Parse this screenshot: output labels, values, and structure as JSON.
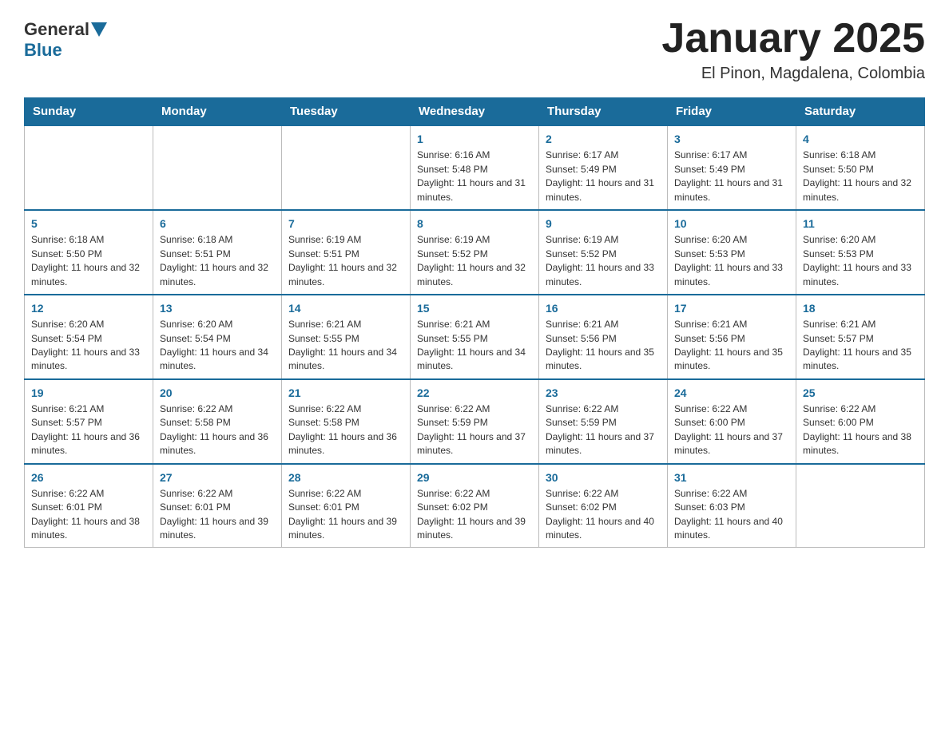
{
  "header": {
    "logo_general": "General",
    "logo_blue": "Blue",
    "month_title": "January 2025",
    "location": "El Pinon, Magdalena, Colombia"
  },
  "weekdays": [
    "Sunday",
    "Monday",
    "Tuesday",
    "Wednesday",
    "Thursday",
    "Friday",
    "Saturday"
  ],
  "weeks": [
    [
      {
        "day": "",
        "info": ""
      },
      {
        "day": "",
        "info": ""
      },
      {
        "day": "",
        "info": ""
      },
      {
        "day": "1",
        "info": "Sunrise: 6:16 AM\nSunset: 5:48 PM\nDaylight: 11 hours and 31 minutes."
      },
      {
        "day": "2",
        "info": "Sunrise: 6:17 AM\nSunset: 5:49 PM\nDaylight: 11 hours and 31 minutes."
      },
      {
        "day": "3",
        "info": "Sunrise: 6:17 AM\nSunset: 5:49 PM\nDaylight: 11 hours and 31 minutes."
      },
      {
        "day": "4",
        "info": "Sunrise: 6:18 AM\nSunset: 5:50 PM\nDaylight: 11 hours and 32 minutes."
      }
    ],
    [
      {
        "day": "5",
        "info": "Sunrise: 6:18 AM\nSunset: 5:50 PM\nDaylight: 11 hours and 32 minutes."
      },
      {
        "day": "6",
        "info": "Sunrise: 6:18 AM\nSunset: 5:51 PM\nDaylight: 11 hours and 32 minutes."
      },
      {
        "day": "7",
        "info": "Sunrise: 6:19 AM\nSunset: 5:51 PM\nDaylight: 11 hours and 32 minutes."
      },
      {
        "day": "8",
        "info": "Sunrise: 6:19 AM\nSunset: 5:52 PM\nDaylight: 11 hours and 32 minutes."
      },
      {
        "day": "9",
        "info": "Sunrise: 6:19 AM\nSunset: 5:52 PM\nDaylight: 11 hours and 33 minutes."
      },
      {
        "day": "10",
        "info": "Sunrise: 6:20 AM\nSunset: 5:53 PM\nDaylight: 11 hours and 33 minutes."
      },
      {
        "day": "11",
        "info": "Sunrise: 6:20 AM\nSunset: 5:53 PM\nDaylight: 11 hours and 33 minutes."
      }
    ],
    [
      {
        "day": "12",
        "info": "Sunrise: 6:20 AM\nSunset: 5:54 PM\nDaylight: 11 hours and 33 minutes."
      },
      {
        "day": "13",
        "info": "Sunrise: 6:20 AM\nSunset: 5:54 PM\nDaylight: 11 hours and 34 minutes."
      },
      {
        "day": "14",
        "info": "Sunrise: 6:21 AM\nSunset: 5:55 PM\nDaylight: 11 hours and 34 minutes."
      },
      {
        "day": "15",
        "info": "Sunrise: 6:21 AM\nSunset: 5:55 PM\nDaylight: 11 hours and 34 minutes."
      },
      {
        "day": "16",
        "info": "Sunrise: 6:21 AM\nSunset: 5:56 PM\nDaylight: 11 hours and 35 minutes."
      },
      {
        "day": "17",
        "info": "Sunrise: 6:21 AM\nSunset: 5:56 PM\nDaylight: 11 hours and 35 minutes."
      },
      {
        "day": "18",
        "info": "Sunrise: 6:21 AM\nSunset: 5:57 PM\nDaylight: 11 hours and 35 minutes."
      }
    ],
    [
      {
        "day": "19",
        "info": "Sunrise: 6:21 AM\nSunset: 5:57 PM\nDaylight: 11 hours and 36 minutes."
      },
      {
        "day": "20",
        "info": "Sunrise: 6:22 AM\nSunset: 5:58 PM\nDaylight: 11 hours and 36 minutes."
      },
      {
        "day": "21",
        "info": "Sunrise: 6:22 AM\nSunset: 5:58 PM\nDaylight: 11 hours and 36 minutes."
      },
      {
        "day": "22",
        "info": "Sunrise: 6:22 AM\nSunset: 5:59 PM\nDaylight: 11 hours and 37 minutes."
      },
      {
        "day": "23",
        "info": "Sunrise: 6:22 AM\nSunset: 5:59 PM\nDaylight: 11 hours and 37 minutes."
      },
      {
        "day": "24",
        "info": "Sunrise: 6:22 AM\nSunset: 6:00 PM\nDaylight: 11 hours and 37 minutes."
      },
      {
        "day": "25",
        "info": "Sunrise: 6:22 AM\nSunset: 6:00 PM\nDaylight: 11 hours and 38 minutes."
      }
    ],
    [
      {
        "day": "26",
        "info": "Sunrise: 6:22 AM\nSunset: 6:01 PM\nDaylight: 11 hours and 38 minutes."
      },
      {
        "day": "27",
        "info": "Sunrise: 6:22 AM\nSunset: 6:01 PM\nDaylight: 11 hours and 39 minutes."
      },
      {
        "day": "28",
        "info": "Sunrise: 6:22 AM\nSunset: 6:01 PM\nDaylight: 11 hours and 39 minutes."
      },
      {
        "day": "29",
        "info": "Sunrise: 6:22 AM\nSunset: 6:02 PM\nDaylight: 11 hours and 39 minutes."
      },
      {
        "day": "30",
        "info": "Sunrise: 6:22 AM\nSunset: 6:02 PM\nDaylight: 11 hours and 40 minutes."
      },
      {
        "day": "31",
        "info": "Sunrise: 6:22 AM\nSunset: 6:03 PM\nDaylight: 11 hours and 40 minutes."
      },
      {
        "day": "",
        "info": ""
      }
    ]
  ]
}
